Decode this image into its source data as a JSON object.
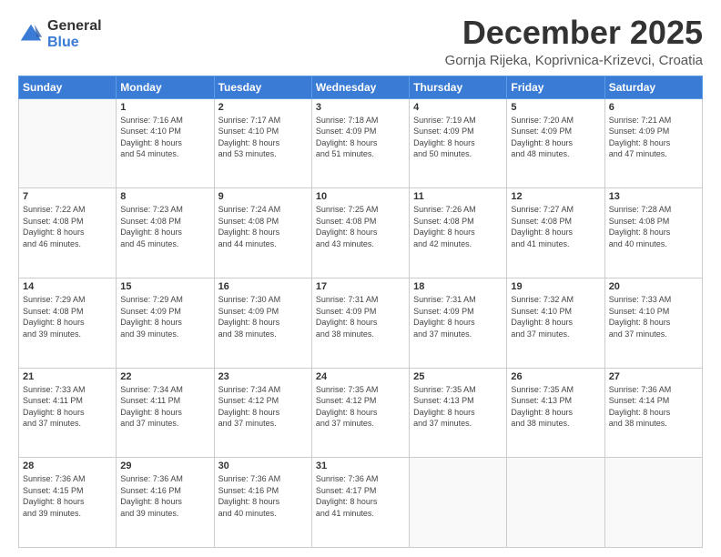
{
  "logo": {
    "general": "General",
    "blue": "Blue"
  },
  "title": "December 2025",
  "subtitle": "Gornja Rijeka, Koprivnica-Krizevci, Croatia",
  "headers": [
    "Sunday",
    "Monday",
    "Tuesday",
    "Wednesday",
    "Thursday",
    "Friday",
    "Saturday"
  ],
  "weeks": [
    [
      {
        "day": "",
        "info": ""
      },
      {
        "day": "1",
        "info": "Sunrise: 7:16 AM\nSunset: 4:10 PM\nDaylight: 8 hours\nand 54 minutes."
      },
      {
        "day": "2",
        "info": "Sunrise: 7:17 AM\nSunset: 4:10 PM\nDaylight: 8 hours\nand 53 minutes."
      },
      {
        "day": "3",
        "info": "Sunrise: 7:18 AM\nSunset: 4:09 PM\nDaylight: 8 hours\nand 51 minutes."
      },
      {
        "day": "4",
        "info": "Sunrise: 7:19 AM\nSunset: 4:09 PM\nDaylight: 8 hours\nand 50 minutes."
      },
      {
        "day": "5",
        "info": "Sunrise: 7:20 AM\nSunset: 4:09 PM\nDaylight: 8 hours\nand 48 minutes."
      },
      {
        "day": "6",
        "info": "Sunrise: 7:21 AM\nSunset: 4:09 PM\nDaylight: 8 hours\nand 47 minutes."
      }
    ],
    [
      {
        "day": "7",
        "info": "Sunrise: 7:22 AM\nSunset: 4:08 PM\nDaylight: 8 hours\nand 46 minutes."
      },
      {
        "day": "8",
        "info": "Sunrise: 7:23 AM\nSunset: 4:08 PM\nDaylight: 8 hours\nand 45 minutes."
      },
      {
        "day": "9",
        "info": "Sunrise: 7:24 AM\nSunset: 4:08 PM\nDaylight: 8 hours\nand 44 minutes."
      },
      {
        "day": "10",
        "info": "Sunrise: 7:25 AM\nSunset: 4:08 PM\nDaylight: 8 hours\nand 43 minutes."
      },
      {
        "day": "11",
        "info": "Sunrise: 7:26 AM\nSunset: 4:08 PM\nDaylight: 8 hours\nand 42 minutes."
      },
      {
        "day": "12",
        "info": "Sunrise: 7:27 AM\nSunset: 4:08 PM\nDaylight: 8 hours\nand 41 minutes."
      },
      {
        "day": "13",
        "info": "Sunrise: 7:28 AM\nSunset: 4:08 PM\nDaylight: 8 hours\nand 40 minutes."
      }
    ],
    [
      {
        "day": "14",
        "info": "Sunrise: 7:29 AM\nSunset: 4:08 PM\nDaylight: 8 hours\nand 39 minutes."
      },
      {
        "day": "15",
        "info": "Sunrise: 7:29 AM\nSunset: 4:09 PM\nDaylight: 8 hours\nand 39 minutes."
      },
      {
        "day": "16",
        "info": "Sunrise: 7:30 AM\nSunset: 4:09 PM\nDaylight: 8 hours\nand 38 minutes."
      },
      {
        "day": "17",
        "info": "Sunrise: 7:31 AM\nSunset: 4:09 PM\nDaylight: 8 hours\nand 38 minutes."
      },
      {
        "day": "18",
        "info": "Sunrise: 7:31 AM\nSunset: 4:09 PM\nDaylight: 8 hours\nand 37 minutes."
      },
      {
        "day": "19",
        "info": "Sunrise: 7:32 AM\nSunset: 4:10 PM\nDaylight: 8 hours\nand 37 minutes."
      },
      {
        "day": "20",
        "info": "Sunrise: 7:33 AM\nSunset: 4:10 PM\nDaylight: 8 hours\nand 37 minutes."
      }
    ],
    [
      {
        "day": "21",
        "info": "Sunrise: 7:33 AM\nSunset: 4:11 PM\nDaylight: 8 hours\nand 37 minutes."
      },
      {
        "day": "22",
        "info": "Sunrise: 7:34 AM\nSunset: 4:11 PM\nDaylight: 8 hours\nand 37 minutes."
      },
      {
        "day": "23",
        "info": "Sunrise: 7:34 AM\nSunset: 4:12 PM\nDaylight: 8 hours\nand 37 minutes."
      },
      {
        "day": "24",
        "info": "Sunrise: 7:35 AM\nSunset: 4:12 PM\nDaylight: 8 hours\nand 37 minutes."
      },
      {
        "day": "25",
        "info": "Sunrise: 7:35 AM\nSunset: 4:13 PM\nDaylight: 8 hours\nand 37 minutes."
      },
      {
        "day": "26",
        "info": "Sunrise: 7:35 AM\nSunset: 4:13 PM\nDaylight: 8 hours\nand 38 minutes."
      },
      {
        "day": "27",
        "info": "Sunrise: 7:36 AM\nSunset: 4:14 PM\nDaylight: 8 hours\nand 38 minutes."
      }
    ],
    [
      {
        "day": "28",
        "info": "Sunrise: 7:36 AM\nSunset: 4:15 PM\nDaylight: 8 hours\nand 39 minutes."
      },
      {
        "day": "29",
        "info": "Sunrise: 7:36 AM\nSunset: 4:16 PM\nDaylight: 8 hours\nand 39 minutes."
      },
      {
        "day": "30",
        "info": "Sunrise: 7:36 AM\nSunset: 4:16 PM\nDaylight: 8 hours\nand 40 minutes."
      },
      {
        "day": "31",
        "info": "Sunrise: 7:36 AM\nSunset: 4:17 PM\nDaylight: 8 hours\nand 41 minutes."
      },
      {
        "day": "",
        "info": ""
      },
      {
        "day": "",
        "info": ""
      },
      {
        "day": "",
        "info": ""
      }
    ]
  ]
}
